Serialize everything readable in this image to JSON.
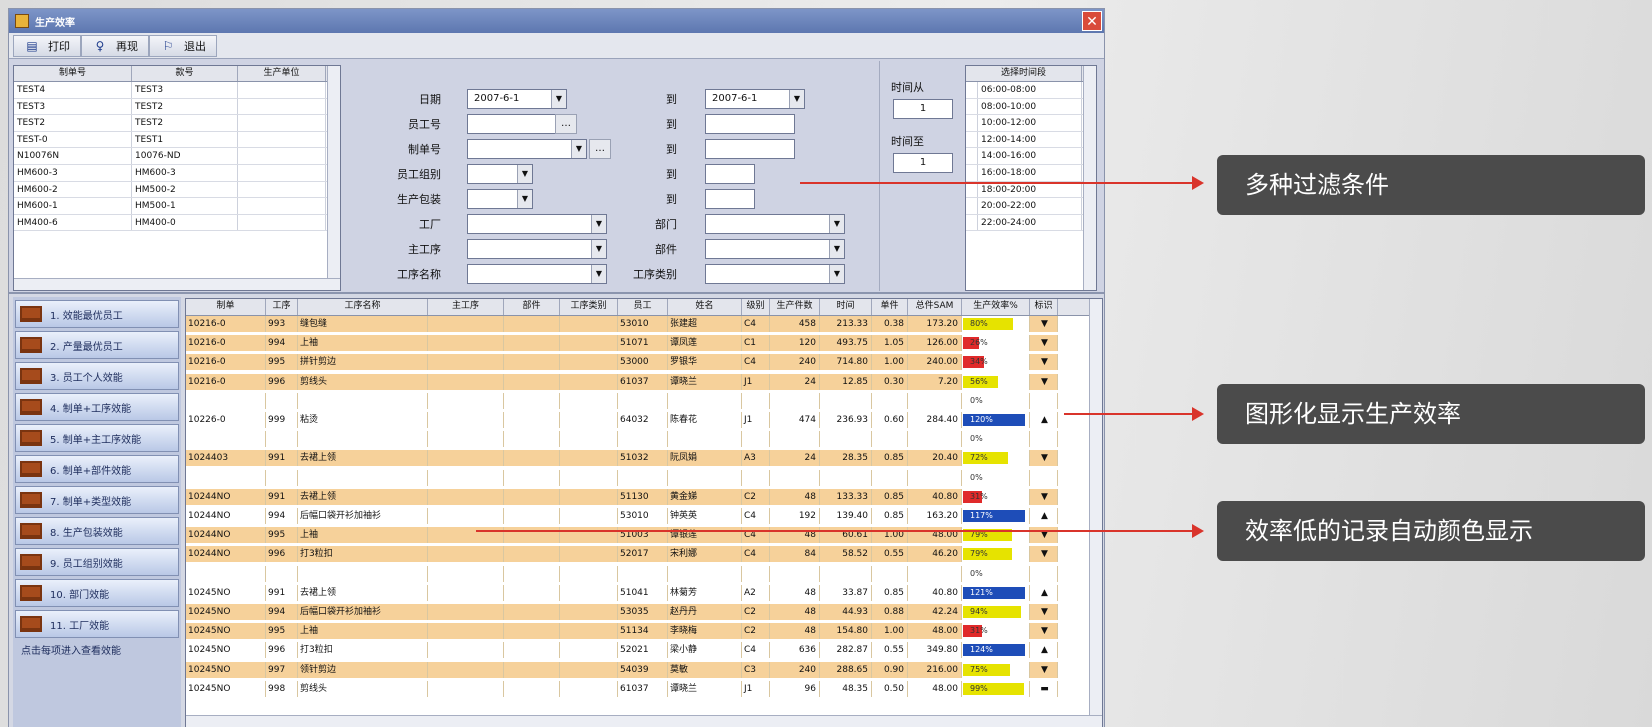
{
  "window": {
    "title": "生产效率"
  },
  "toolbar": {
    "print": "打印",
    "preview": "再现",
    "exit": "退出"
  },
  "order_list": {
    "headers": [
      "制单号",
      "款号",
      "生产单位"
    ],
    "rows": [
      [
        "TEST4",
        "TEST3",
        ""
      ],
      [
        "TEST3",
        "TEST2",
        ""
      ],
      [
        "TEST2",
        "TEST2",
        ""
      ],
      [
        "TEST-0",
        "TEST1",
        ""
      ],
      [
        "N10076N",
        "10076-ND",
        ""
      ],
      [
        "HM600-3",
        "HM600-3",
        ""
      ],
      [
        "HM600-2",
        "HM500-2",
        ""
      ],
      [
        "HM600-1",
        "HM500-1",
        ""
      ],
      [
        "HM400-6",
        "HM400-0",
        ""
      ]
    ]
  },
  "filters": {
    "date_label": "日期",
    "date_from": "2007-6-1",
    "to_label": "到",
    "date_to": "2007-6-1",
    "emp_no_label": "员工号",
    "order_no_label": "制单号",
    "emp_cat_label": "员工组别",
    "prod_pack_label": "生产包装",
    "factory_label": "工厂",
    "main_proc_label": "主工序",
    "proc_name_label": "工序名称",
    "to1": "到",
    "to2": "到",
    "to3": "到",
    "to4": "到",
    "dept_label": "部门",
    "part_label": "部件",
    "proc_type_label": "工序类别",
    "time_from_label": "时间从",
    "time_from": "1",
    "time_to_label": "时间至",
    "time_to": "1"
  },
  "time_slots": {
    "header": "选择时间段",
    "items": [
      "06:00-08:00",
      "08:00-10:00",
      "10:00-12:00",
      "12:00-14:00",
      "14:00-16:00",
      "16:00-18:00",
      "18:00-20:00",
      "20:00-22:00",
      "22:00-24:00"
    ]
  },
  "nav": {
    "items": [
      "1. 效能最优员工",
      "2. 产量最优员工",
      "3. 员工个人效能",
      "4. 制单+工序效能",
      "5. 制单+主工序效能",
      "6. 制单+部件效能",
      "7. 制单+类型效能",
      "8. 生产包装效能",
      "9. 员工组别效能",
      "10. 部门效能",
      "11. 工厂效能"
    ],
    "footer": "点击每项进入查看效能"
  },
  "datagrid": {
    "headers": [
      "制单",
      "工序",
      "工序名称",
      "主工序",
      "部件",
      "工序类别",
      "员工",
      "姓名",
      "级别",
      "生产件数",
      "时间",
      "单件SAM",
      "总件SAM",
      "生产效率%",
      "标识"
    ],
    "rows": [
      {
        "order": "10216-0",
        "proc": "993",
        "name": "缝包缝",
        "main": "",
        "part": "",
        "type": "",
        "emp": "53010",
        "nm": "张建超",
        "lvl": "C4",
        "qty": "458",
        "time": "213.33",
        "sam": "0.38",
        "tsam": "173.20",
        "eff": 0.8,
        "eff_txt": "80%",
        "color": "#e6e300",
        "flag": "▼",
        "bg": "#f6d19a"
      },
      {
        "order": "10216-0",
        "proc": "994",
        "name": "上袖",
        "main": "",
        "part": "",
        "type": "",
        "emp": "51071",
        "nm": "谭凤莲",
        "lvl": "C1",
        "qty": "120",
        "time": "493.75",
        "sam": "1.05",
        "tsam": "126.00",
        "eff": 0.26,
        "eff_txt": "26%",
        "color": "#e02a2a",
        "flag": "▼",
        "bg": "#f6d19a"
      },
      {
        "order": "10216-0",
        "proc": "995",
        "name": "拼针剪边",
        "main": "",
        "part": "",
        "type": "",
        "emp": "53000",
        "nm": "罗银华",
        "lvl": "C4",
        "qty": "240",
        "time": "714.80",
        "sam": "1.00",
        "tsam": "240.00",
        "eff": 0.34,
        "eff_txt": "34%",
        "color": "#e02a2a",
        "flag": "▼",
        "bg": "#f6d19a"
      },
      {
        "order": "10216-0",
        "proc": "996",
        "name": "剪线头",
        "main": "",
        "part": "",
        "type": "",
        "emp": "61037",
        "nm": "谭晓兰",
        "lvl": "J1",
        "qty": "24",
        "time": "12.85",
        "sam": "0.30",
        "tsam": "7.20",
        "eff": 0.56,
        "eff_txt": "56%",
        "color": "#e6e300",
        "flag": "▼",
        "bg": "#f6d19a"
      },
      {
        "order": "",
        "proc": "",
        "name": "",
        "main": "",
        "part": "",
        "type": "",
        "emp": "",
        "nm": "",
        "lvl": "",
        "qty": "",
        "time": "",
        "sam": "",
        "tsam": "",
        "eff": null,
        "eff_txt": "0%",
        "color": "",
        "flag": "",
        "bg": "#ffffff"
      },
      {
        "order": "10226-0",
        "proc": "999",
        "name": "粘烫",
        "main": "",
        "part": "",
        "type": "",
        "emp": "64032",
        "nm": "陈春花",
        "lvl": "J1",
        "qty": "474",
        "time": "236.93",
        "sam": "0.60",
        "tsam": "284.40",
        "eff": 1.0,
        "eff_txt": "120%",
        "color": "#1e4db8",
        "flag": "▲",
        "bg": "#ffffff"
      },
      {
        "order": "",
        "proc": "",
        "name": "",
        "main": "",
        "part": "",
        "type": "",
        "emp": "",
        "nm": "",
        "lvl": "",
        "qty": "",
        "time": "",
        "sam": "",
        "tsam": "",
        "eff": null,
        "eff_txt": "0%",
        "color": "",
        "flag": "",
        "bg": "#ffffff"
      },
      {
        "order": "1024403",
        "proc": "991",
        "name": "去裙上领",
        "main": "",
        "part": "",
        "type": "",
        "emp": "51032",
        "nm": "阮凤娟",
        "lvl": "A3",
        "qty": "24",
        "time": "28.35",
        "sam": "0.85",
        "tsam": "20.40",
        "eff": 0.72,
        "eff_txt": "72%",
        "color": "#e6e300",
        "flag": "▼",
        "bg": "#f6d19a"
      },
      {
        "order": "",
        "proc": "",
        "name": "",
        "main": "",
        "part": "",
        "type": "",
        "emp": "",
        "nm": "",
        "lvl": "",
        "qty": "",
        "time": "",
        "sam": "",
        "tsam": "",
        "eff": null,
        "eff_txt": "0%",
        "color": "",
        "flag": "",
        "bg": "#ffffff"
      },
      {
        "order": "10244NO",
        "proc": "991",
        "name": "去裙上领",
        "main": "",
        "part": "",
        "type": "",
        "emp": "51130",
        "nm": "黄金娣",
        "lvl": "C2",
        "qty": "48",
        "time": "133.33",
        "sam": "0.85",
        "tsam": "40.80",
        "eff": 0.31,
        "eff_txt": "31%",
        "color": "#e02a2a",
        "flag": "▼",
        "bg": "#f6d19a"
      },
      {
        "order": "10244NO",
        "proc": "994",
        "name": "后幅口袋开衫加袖衫",
        "main": "",
        "part": "",
        "type": "",
        "emp": "53010",
        "nm": "钟英英",
        "lvl": "C4",
        "qty": "192",
        "time": "139.40",
        "sam": "0.85",
        "tsam": "163.20",
        "eff": 1.0,
        "eff_txt": "117%",
        "color": "#1e4db8",
        "flag": "▲",
        "bg": "#ffffff"
      },
      {
        "order": "10244NO",
        "proc": "995",
        "name": "上袖",
        "main": "",
        "part": "",
        "type": "",
        "emp": "51003",
        "nm": "谭银莲",
        "lvl": "C4",
        "qty": "48",
        "time": "60.61",
        "sam": "1.00",
        "tsam": "48.00",
        "eff": 0.79,
        "eff_txt": "79%",
        "color": "#e6e300",
        "flag": "▼",
        "bg": "#f6d19a"
      },
      {
        "order": "10244NO",
        "proc": "996",
        "name": "打3粒扣",
        "main": "",
        "part": "",
        "type": "",
        "emp": "52017",
        "nm": "宋利娜",
        "lvl": "C4",
        "qty": "84",
        "time": "58.52",
        "sam": "0.55",
        "tsam": "46.20",
        "eff": 0.79,
        "eff_txt": "79%",
        "color": "#e6e300",
        "flag": "▼",
        "bg": "#f6d19a"
      },
      {
        "order": "",
        "proc": "",
        "name": "",
        "main": "",
        "part": "",
        "type": "",
        "emp": "",
        "nm": "",
        "lvl": "",
        "qty": "",
        "time": "",
        "sam": "",
        "tsam": "",
        "eff": null,
        "eff_txt": "0%",
        "color": "",
        "flag": "",
        "bg": "#ffffff"
      },
      {
        "order": "10245NO",
        "proc": "991",
        "name": "去裙上领",
        "main": "",
        "part": "",
        "type": "",
        "emp": "51041",
        "nm": "林菊芳",
        "lvl": "A2",
        "qty": "48",
        "time": "33.87",
        "sam": "0.85",
        "tsam": "40.80",
        "eff": 1.0,
        "eff_txt": "121%",
        "color": "#1e4db8",
        "flag": "▲",
        "bg": "#ffffff"
      },
      {
        "order": "10245NO",
        "proc": "994",
        "name": "后幅口袋开衫加袖衫",
        "main": "",
        "part": "",
        "type": "",
        "emp": "53035",
        "nm": "赵丹丹",
        "lvl": "C2",
        "qty": "48",
        "time": "44.93",
        "sam": "0.88",
        "tsam": "42.24",
        "eff": 0.94,
        "eff_txt": "94%",
        "color": "#e6e300",
        "flag": "▼",
        "bg": "#f6d19a"
      },
      {
        "order": "10245NO",
        "proc": "995",
        "name": "上袖",
        "main": "",
        "part": "",
        "type": "",
        "emp": "51134",
        "nm": "李晓梅",
        "lvl": "C2",
        "qty": "48",
        "time": "154.80",
        "sam": "1.00",
        "tsam": "48.00",
        "eff": 0.31,
        "eff_txt": "31%",
        "color": "#e02a2a",
        "flag": "▼",
        "bg": "#f6d19a"
      },
      {
        "order": "10245NO",
        "proc": "996",
        "name": "打3粒扣",
        "main": "",
        "part": "",
        "type": "",
        "emp": "52021",
        "nm": "梁小静",
        "lvl": "C4",
        "qty": "636",
        "time": "282.87",
        "sam": "0.55",
        "tsam": "349.80",
        "eff": 1.0,
        "eff_txt": "124%",
        "color": "#1e4db8",
        "flag": "▲",
        "bg": "#ffffff"
      },
      {
        "order": "10245NO",
        "proc": "997",
        "name": "领针剪边",
        "main": "",
        "part": "",
        "type": "",
        "emp": "54039",
        "nm": "莫敏",
        "lvl": "C3",
        "qty": "240",
        "time": "288.65",
        "sam": "0.90",
        "tsam": "216.00",
        "eff": 0.75,
        "eff_txt": "75%",
        "color": "#e6e300",
        "flag": "▼",
        "bg": "#f6d19a"
      },
      {
        "order": "10245NO",
        "proc": "998",
        "name": "剪线头",
        "main": "",
        "part": "",
        "type": "",
        "emp": "61037",
        "nm": "谭晓兰",
        "lvl": "J1",
        "qty": "96",
        "time": "48.35",
        "sam": "0.50",
        "tsam": "48.00",
        "eff": 0.99,
        "eff_txt": "99%",
        "color": "#e6e300",
        "flag": "▬",
        "bg": "#ffffff"
      }
    ]
  },
  "callouts": {
    "filters": "多种过滤条件",
    "chart": "图形化显示生产效率",
    "color": "效率低的记录自动颜色显示"
  }
}
